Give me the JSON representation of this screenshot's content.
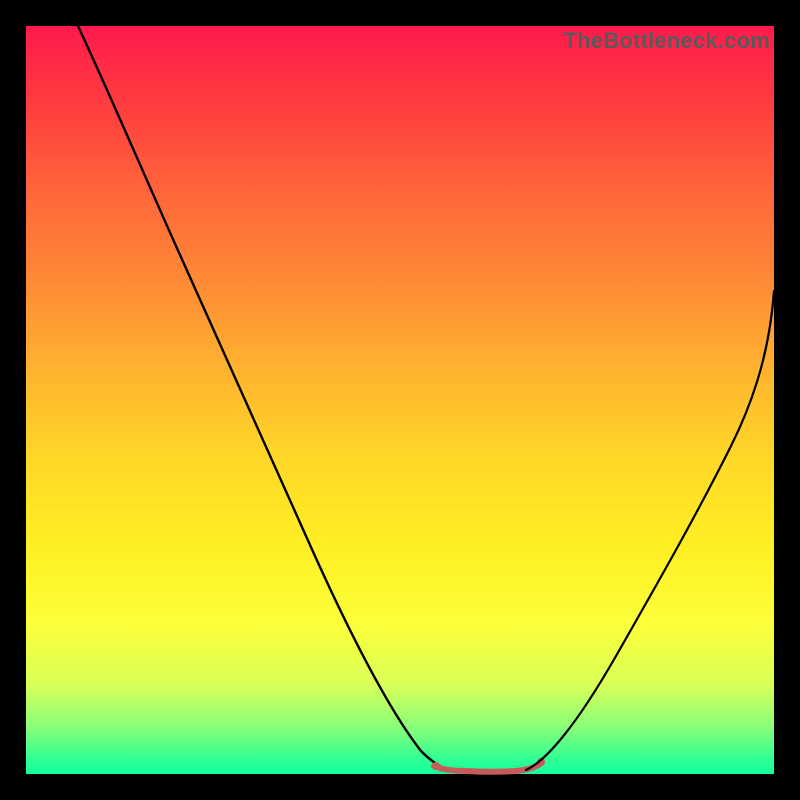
{
  "watermark": "TheBottleneck.com",
  "chart_data": {
    "type": "line",
    "title": "",
    "xlabel": "",
    "ylabel": "",
    "xlim": [
      0,
      100
    ],
    "ylim": [
      0,
      100
    ],
    "series": [
      {
        "name": "left-curve",
        "color": "#000000",
        "x": [
          7,
          10,
          14,
          18,
          23,
          28,
          33,
          38,
          43,
          47,
          51,
          54,
          56
        ],
        "y": [
          100,
          93,
          84,
          75,
          64,
          53,
          42,
          31,
          20,
          12,
          6,
          2,
          0.7
        ]
      },
      {
        "name": "valley-floor",
        "color": "#d15a5a",
        "x": [
          54,
          56,
          58,
          61,
          64,
          66,
          68
        ],
        "y": [
          1.2,
          0.6,
          0.4,
          0.4,
          0.4,
          0.6,
          1.3
        ]
      },
      {
        "name": "right-curve",
        "color": "#000000",
        "x": [
          66,
          69,
          73,
          77,
          81,
          85,
          89,
          93,
          97,
          100
        ],
        "y": [
          0.8,
          4,
          10,
          18,
          27,
          36,
          45,
          53,
          60,
          65
        ]
      }
    ]
  }
}
